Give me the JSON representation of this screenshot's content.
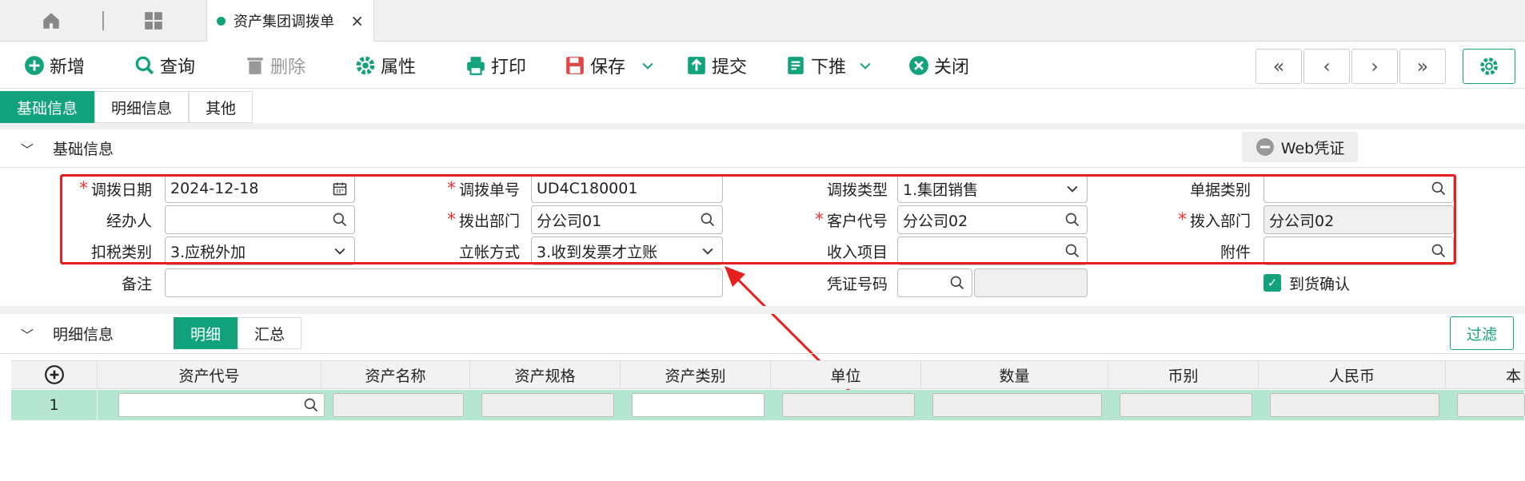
{
  "tabbar": {
    "doc_tab_title": "资产集团调拨单",
    "close_glyph": "×"
  },
  "toolbar": {
    "add": "新增",
    "query": "查询",
    "delete": "删除",
    "props": "属性",
    "print": "打印",
    "save": "保存",
    "submit": "提交",
    "push": "下推",
    "close": "关闭"
  },
  "nav": {
    "first": "«",
    "prev": "‹",
    "next": "›",
    "last": "»"
  },
  "subtabs": [
    "基础信息",
    "明细信息",
    "其他"
  ],
  "basic": {
    "section_title": "基础信息",
    "web_voucher": "Web凭证",
    "fields": {
      "date_label": "调拨日期",
      "date_value": "2024-12-18",
      "no_label": "调拨单号",
      "no_value": "UD4C180001",
      "type_label": "调拨类型",
      "type_value": "1.集团销售",
      "billtype_label": "单据类别",
      "billtype_value": "",
      "handler_label": "经办人",
      "handler_value": "",
      "outdept_label": "拨出部门",
      "outdept_value": "分公司01",
      "custcode_label": "客户代号",
      "custcode_value": "分公司02",
      "indept_label": "拨入部门",
      "indept_value": "分公司02",
      "tax_label": "扣税类别",
      "tax_value": "3.应税外加",
      "account_label": "立帐方式",
      "account_value": "3.收到发票才立账",
      "income_label": "收入项目",
      "income_value": "",
      "attach_label": "附件",
      "attach_value": "",
      "remark_label": "备注",
      "remark_value": "",
      "voucher_label": "凭证号码",
      "voucher_value": "",
      "arrival_label": "到货确认"
    }
  },
  "detail": {
    "section_title": "明细信息",
    "tabs": [
      "明细",
      "汇总"
    ],
    "filter": "过滤",
    "columns": [
      "资产代号",
      "资产名称",
      "资产规格",
      "资产类别",
      "单位",
      "数量",
      "币别",
      "人民币",
      "本"
    ],
    "rows": [
      {
        "index": "1"
      }
    ]
  },
  "colors": {
    "accent": "#12a37c",
    "highlight": "#e5201f",
    "row": "#b4e6d2"
  }
}
